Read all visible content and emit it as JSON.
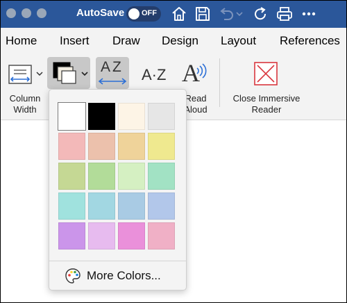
{
  "titlebar": {
    "autosave_label": "AutoSave",
    "toggle_state": "OFF"
  },
  "tabs": [
    {
      "label": "Home"
    },
    {
      "label": "Insert"
    },
    {
      "label": "Draw"
    },
    {
      "label": "Design"
    },
    {
      "label": "Layout"
    },
    {
      "label": "References"
    }
  ],
  "ribbon": {
    "column_width": {
      "line1": "Column",
      "line2": "Width"
    },
    "read_aloud": {
      "line1": "Read",
      "line2": "Aloud"
    },
    "spacing_icon_text": "AZ",
    "syllables_icon_text": "A·Z",
    "read_icon_text": "A",
    "close_immersive": {
      "line1": "Close Immersive",
      "line2": "Reader"
    }
  },
  "page_color_panel": {
    "swatches": [
      {
        "color": "#ffffff",
        "selected": true
      },
      {
        "color": "#000000",
        "selected": false
      },
      {
        "color": "#fdf4e6",
        "selected": false
      },
      {
        "color": "#e6e6e6",
        "selected": false
      },
      {
        "color": "#f3b9b9",
        "selected": false
      },
      {
        "color": "#ecc1ac",
        "selected": false
      },
      {
        "color": "#efd39a",
        "selected": false
      },
      {
        "color": "#efe98f",
        "selected": false
      },
      {
        "color": "#c5d894",
        "selected": false
      },
      {
        "color": "#b2dc99",
        "selected": false
      },
      {
        "color": "#d5f0c2",
        "selected": false
      },
      {
        "color": "#a2e2c4",
        "selected": false
      },
      {
        "color": "#a0e2de",
        "selected": false
      },
      {
        "color": "#a2d7e2",
        "selected": false
      },
      {
        "color": "#a9cbe4",
        "selected": false
      },
      {
        "color": "#b2c7ea",
        "selected": false
      },
      {
        "color": "#cb95ea",
        "selected": false
      },
      {
        "color": "#e7bbef",
        "selected": false
      },
      {
        "color": "#ea90da",
        "selected": false
      },
      {
        "color": "#f0b0c6",
        "selected": false
      }
    ],
    "more_colors_label": "More Colors..."
  },
  "colors": {
    "titlebar_bg": "#2b579a",
    "ribbon_bg": "#f3f3f3",
    "close_icon_red": "#d9363e",
    "accent_blue": "#2b579a"
  }
}
